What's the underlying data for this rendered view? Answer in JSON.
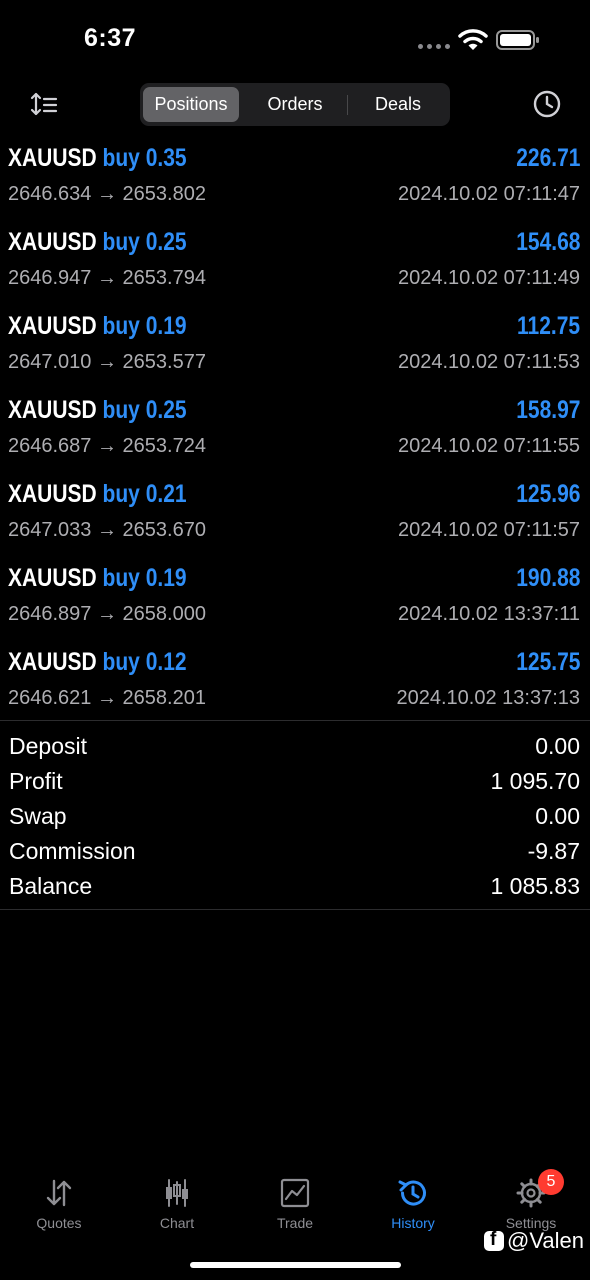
{
  "status_bar": {
    "time": "6:37"
  },
  "navbar": {
    "segments": [
      {
        "label": "Positions",
        "active": true
      },
      {
        "label": "Orders",
        "active": false
      },
      {
        "label": "Deals",
        "active": false
      }
    ],
    "left_icon": "sort-icon",
    "right_icon": "clock-icon"
  },
  "positions": [
    {
      "symbol": "XAUUSD",
      "direction": "buy",
      "volume": "0.35",
      "profit": "226.71",
      "prices": "2646.634 → 2653.802",
      "time": "2024.10.02 07:11:47"
    },
    {
      "symbol": "XAUUSD",
      "direction": "buy",
      "volume": "0.25",
      "profit": "154.68",
      "prices": "2646.947 → 2653.794",
      "time": "2024.10.02 07:11:49"
    },
    {
      "symbol": "XAUUSD",
      "direction": "buy",
      "volume": "0.19",
      "profit": "112.75",
      "prices": "2647.010 → 2653.577",
      "time": "2024.10.02 07:11:53"
    },
    {
      "symbol": "XAUUSD",
      "direction": "buy",
      "volume": "0.25",
      "profit": "158.97",
      "prices": "2646.687 → 2653.724",
      "time": "2024.10.02 07:11:55"
    },
    {
      "symbol": "XAUUSD",
      "direction": "buy",
      "volume": "0.21",
      "profit": "125.96",
      "prices": "2647.033 → 2653.670",
      "time": "2024.10.02 07:11:57"
    },
    {
      "symbol": "XAUUSD",
      "direction": "buy",
      "volume": "0.19",
      "profit": "190.88",
      "prices": "2646.897 → 2658.000",
      "time": "2024.10.02 13:37:11"
    },
    {
      "symbol": "XAUUSD",
      "direction": "buy",
      "volume": "0.12",
      "profit": "125.75",
      "prices": "2646.621 → 2658.201",
      "time": "2024.10.02 13:37:13"
    }
  ],
  "summary": [
    {
      "label": "Deposit",
      "value": "0.00"
    },
    {
      "label": "Profit",
      "value": "1 095.70"
    },
    {
      "label": "Swap",
      "value": "0.00"
    },
    {
      "label": "Commission",
      "value": "-9.87"
    },
    {
      "label": "Balance",
      "value": "1 085.83"
    }
  ],
  "tabbar": {
    "tabs": [
      {
        "label": "Quotes",
        "icon": "quotes-icon",
        "active": false
      },
      {
        "label": "Chart",
        "icon": "candlestick-icon",
        "active": false
      },
      {
        "label": "Trade",
        "icon": "trade-icon",
        "active": false
      },
      {
        "label": "History",
        "icon": "history-icon",
        "active": true
      },
      {
        "label": "Settings",
        "icon": "gear-icon",
        "active": false,
        "badge": "5"
      }
    ]
  },
  "watermark": {
    "text": "@Valen",
    "icon": "facebook-icon"
  },
  "colors": {
    "accent": "#2f8ef7",
    "background": "#000000",
    "secondary_text": "#aeaeb2",
    "badge": "#ff3b30"
  }
}
